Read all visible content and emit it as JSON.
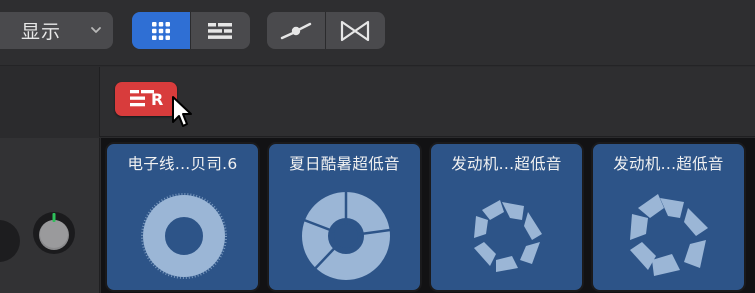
{
  "toolbar": {
    "show_menu_label": "显示",
    "show_menu_icon": "chevron-down-icon",
    "view_buttons": [
      {
        "name": "grid-view-button",
        "icon": "grid-icon",
        "active": true
      },
      {
        "name": "list-view-button",
        "icon": "list-icon",
        "active": false
      }
    ],
    "curve_buttons": [
      {
        "name": "automation-curve-button",
        "icon": "curve-node-icon"
      },
      {
        "name": "crossfade-button",
        "icon": "bowtie-icon"
      }
    ]
  },
  "record_button": {
    "label": "R",
    "icon": "list-record-icon",
    "color": "#d83c3c"
  },
  "cells": [
    {
      "title": "电子线...贝司.6",
      "waveform": "ring"
    },
    {
      "title": "夏日酷暑超低音",
      "waveform": "ring-notched"
    },
    {
      "title": "发动机...超低音",
      "waveform": "spiral"
    },
    {
      "title": "发动机...超低音",
      "waveform": "spiral"
    }
  ],
  "colors": {
    "accent": "#2f6fd4",
    "cell": "#2d5488",
    "waveform": "#9bb6d6",
    "record": "#d83c3c"
  }
}
